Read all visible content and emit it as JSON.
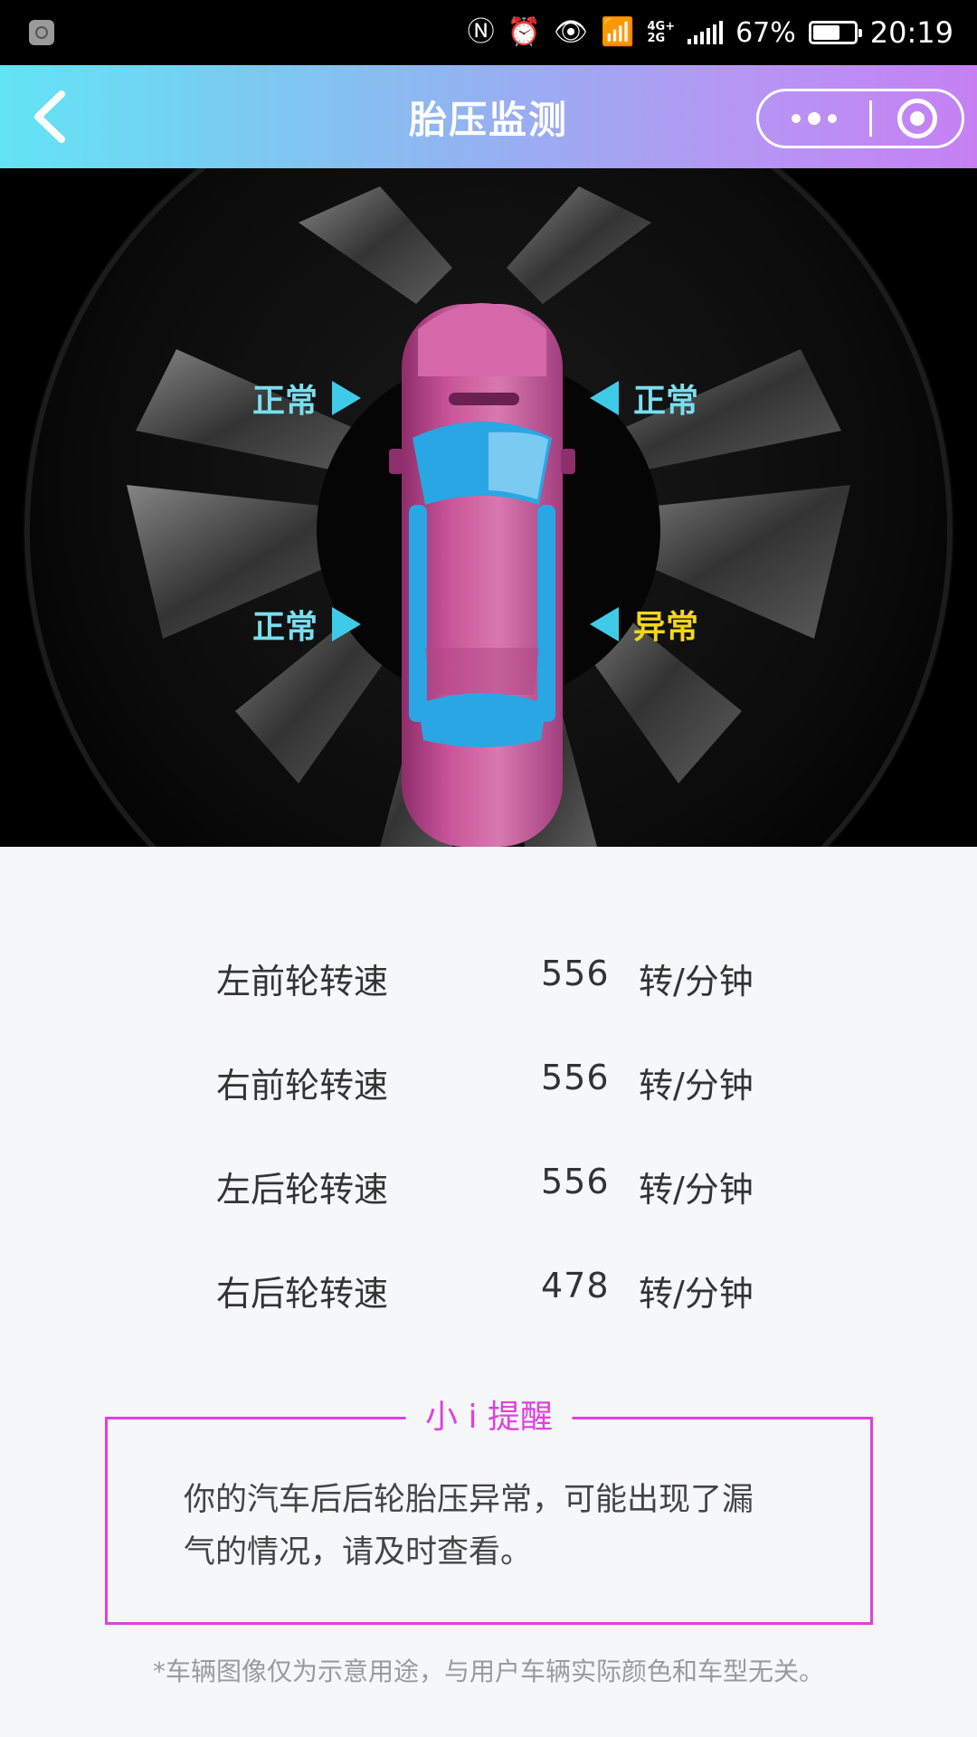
{
  "status_bar": {
    "network": "4G+\n2G",
    "battery": "67%",
    "battery_level": 0.67,
    "time": "20:19"
  },
  "header": {
    "title": "胎压监测",
    "back_icon": "chevron-left-icon",
    "more_icon": "more-dots-icon",
    "close_icon": "target-ring-icon"
  },
  "tires": {
    "front_left": {
      "status": "正常",
      "state": "ok"
    },
    "front_right": {
      "status": "正常",
      "state": "ok"
    },
    "rear_left": {
      "status": "正常",
      "state": "ok"
    },
    "rear_right": {
      "status": "异常",
      "state": "abnormal"
    }
  },
  "colors": {
    "ok": "#79dff0",
    "abnormal": "#f3d61a",
    "accent": "#e040e0",
    "car_body": "#c9559a"
  },
  "speeds": [
    {
      "name": "左前轮转速",
      "value": "556",
      "unit": "转/分钟"
    },
    {
      "name": "右前轮转速",
      "value": "556",
      "unit": "转/分钟"
    },
    {
      "name": "左后轮转速",
      "value": "556",
      "unit": "转/分钟"
    },
    {
      "name": "右后轮转速",
      "value": "478",
      "unit": "转/分钟"
    }
  ],
  "reminder": {
    "title": "小 i 提醒",
    "line1": "你的汽车后后轮胎压异常，可能出现了漏",
    "line2": "气的情况，请及时查看。"
  },
  "disclaimer": "*车辆图像仅为示意用途，与用户车辆实际颜色和车型无关。"
}
